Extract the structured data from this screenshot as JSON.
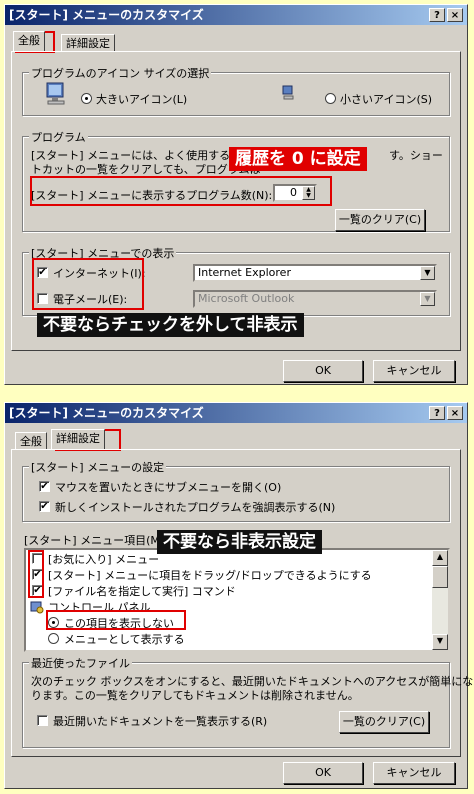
{
  "dialog1": {
    "title": "[スタート] メニューのカスタマイズ",
    "help": "?",
    "close": "×",
    "tab_general": "全般",
    "tab_advanced": "詳細設定",
    "icon_group_label": "プログラムのアイコン サイズの選択",
    "large_icons": "大きいアイコン(L)",
    "small_icons": "小さいアイコン(S)",
    "programs_group_label": "プログラム",
    "programs_desc1": "[スタート] メニューには、よく使用するプログラ",
    "programs_desc1b": "す。ショー",
    "programs_desc2": "トカットの一覧をクリアしても、プログラムは",
    "num_programs_label": "[スタート] メニューに表示するプログラム数(N):",
    "num_programs_value": "0",
    "clear_list_button": "一覧のクリア(C)",
    "show_group_label": "[スタート] メニューでの表示",
    "internet_label": "インターネット(I):",
    "internet_value": "Internet Explorer",
    "email_label": "電子メール(E):",
    "email_value": "Microsoft Outlook",
    "callout_history": "履歴を 0 に設定",
    "callout_uncheck": "不要ならチェックを外して非表示",
    "ok": "OK",
    "cancel": "キャンセル"
  },
  "dialog2": {
    "title": "[スタート] メニューのカスタマイズ",
    "help": "?",
    "close": "×",
    "tab_general": "全般",
    "tab_advanced": "詳細設定",
    "settings_group_label": "[スタート] メニューの設定",
    "opt_hover": "マウスを置いたときにサブメニューを開く(O)",
    "opt_highlight": "新しくインストールされたプログラムを強調表示する(N)",
    "items_label": "[スタート] メニュー項目(M):",
    "items": [
      "[お気に入り] メニュー",
      "[スタート] メニューに項目をドラッグ/ドロップできるようにする",
      "[ファイル名を指定して実行] コマンド",
      "コントロール パネル",
      "この項目を表示しない",
      "メニューとして表示する"
    ],
    "recent_group_label": "最近使ったファイル",
    "recent_desc1": "次のチェック ボックスをオンにすると、最近開いたドキュメントへのアクセスが簡単にな",
    "recent_desc2": "ります。この一覧をクリアしてもドキュメントは削除されません。",
    "recent_check": "最近開いたドキュメントを一覧表示する(R)",
    "clear_list_button": "一覧のクリア(C)",
    "callout_hide": "不要なら非表示設定",
    "ok": "OK",
    "cancel": "キャンセル"
  }
}
